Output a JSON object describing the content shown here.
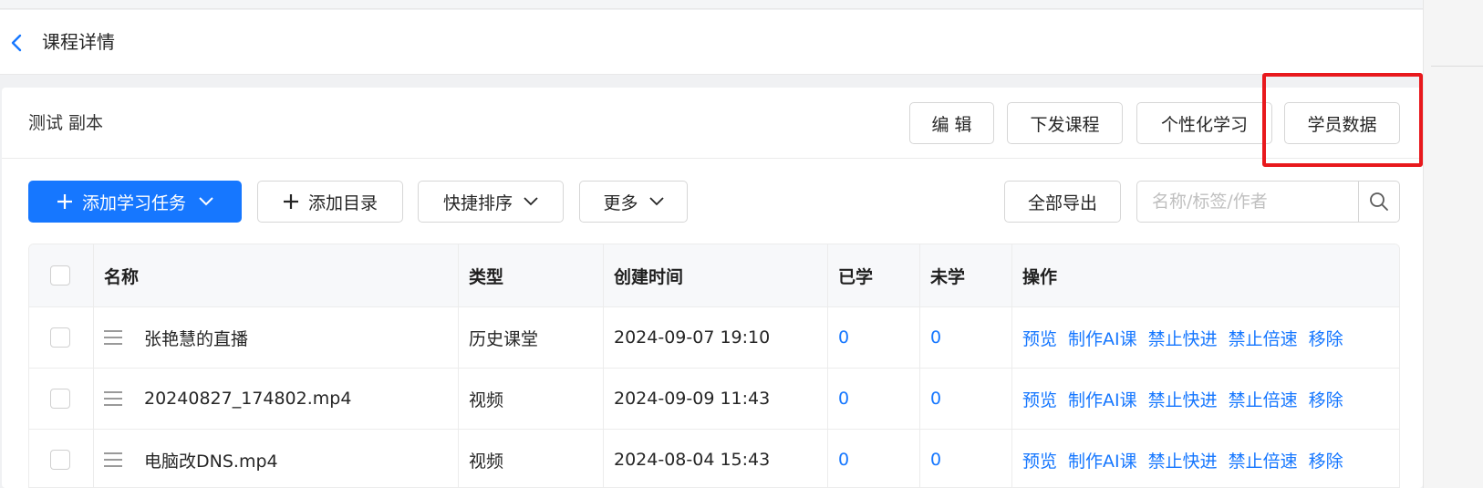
{
  "header": {
    "title": "课程详情",
    "back_icon": "chevron-left-icon"
  },
  "course": {
    "name": "测试 副本"
  },
  "actions": {
    "edit": "编 辑",
    "distribute": "下发课程",
    "personalized": "个性化学习",
    "student_data": "学员数据"
  },
  "toolbar": {
    "add_task": "添加学习任务",
    "add_catalog": "添加目录",
    "quick_sort": "快捷排序",
    "more": "更多",
    "export_all": "全部导出"
  },
  "search": {
    "placeholder": "名称/标签/作者",
    "value": ""
  },
  "table": {
    "columns": [
      "名称",
      "类型",
      "创建时间",
      "已学",
      "未学",
      "操作"
    ],
    "operations": [
      "预览",
      "制作AI课",
      "禁止快进",
      "禁止倍速",
      "移除"
    ],
    "rows": [
      {
        "name": "张艳慧的直播",
        "type": "历史课堂",
        "created": "2024-09-07 19:10",
        "learned": "0",
        "unlearned": "0"
      },
      {
        "name": "20240827_174802.mp4",
        "type": "视频",
        "created": "2024-09-09 11:43",
        "learned": "0",
        "unlearned": "0"
      },
      {
        "name": "电脑改DNS.mp4",
        "type": "视频",
        "created": "2024-08-04 15:43",
        "learned": "0",
        "unlearned": "0"
      }
    ]
  },
  "colors": {
    "primary": "#1677ff",
    "highlight": "#e8191d"
  }
}
